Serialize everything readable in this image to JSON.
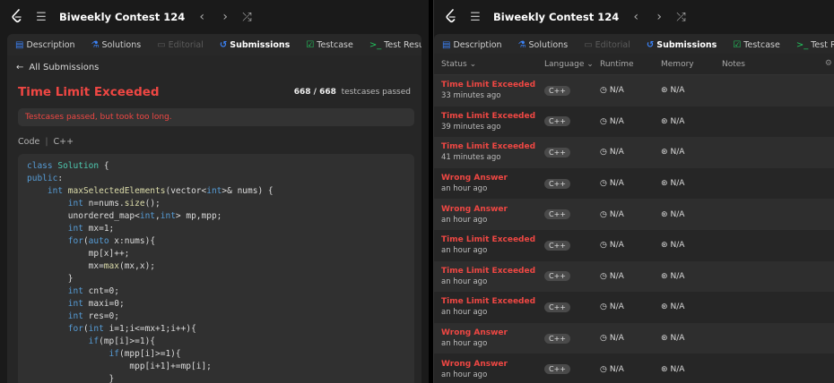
{
  "left": {
    "contest_title": "Biweekly Contest 124",
    "tabs": [
      {
        "label": "Description",
        "icon": "description-icon"
      },
      {
        "label": "Solutions",
        "icon": "flask-icon"
      },
      {
        "label": "Editorial",
        "icon": "book-icon",
        "disabled": true
      },
      {
        "label": "Submissions",
        "icon": "history-icon",
        "active": true
      },
      {
        "label": "Testcase",
        "icon": "checkbox-icon"
      },
      {
        "label": "Test Result",
        "icon": "terminal-icon"
      }
    ],
    "back_label": "All Submissions",
    "verdict": "Time Limit Exceeded",
    "passed_count": "668 / 668",
    "passed_suffix": "testcases passed",
    "message": "Testcases passed, but took too long.",
    "code_label": "Code",
    "code_lang": "C++"
  },
  "right": {
    "contest_title": "Biweekly Contest 124",
    "tabs": [
      {
        "label": "Description"
      },
      {
        "label": "Solutions"
      },
      {
        "label": "Editorial"
      },
      {
        "label": "Submissions"
      },
      {
        "label": "Testcase"
      },
      {
        "label": "Test Result"
      }
    ],
    "columns": {
      "status": "Status",
      "language": "Language",
      "runtime": "Runtime",
      "memory": "Memory",
      "notes": "Notes"
    },
    "rows": [
      {
        "status": "Time Limit Exceeded",
        "time": "33 minutes ago",
        "lang": "C++",
        "runtime": "N/A",
        "memory": "N/A"
      },
      {
        "status": "Time Limit Exceeded",
        "time": "39 minutes ago",
        "lang": "C++",
        "runtime": "N/A",
        "memory": "N/A"
      },
      {
        "status": "Time Limit Exceeded",
        "time": "41 minutes ago",
        "lang": "C++",
        "runtime": "N/A",
        "memory": "N/A"
      },
      {
        "status": "Wrong Answer",
        "time": "an hour ago",
        "lang": "C++",
        "runtime": "N/A",
        "memory": "N/A"
      },
      {
        "status": "Wrong Answer",
        "time": "an hour ago",
        "lang": "C++",
        "runtime": "N/A",
        "memory": "N/A"
      },
      {
        "status": "Time Limit Exceeded",
        "time": "an hour ago",
        "lang": "C++",
        "runtime": "N/A",
        "memory": "N/A"
      },
      {
        "status": "Time Limit Exceeded",
        "time": "an hour ago",
        "lang": "C++",
        "runtime": "N/A",
        "memory": "N/A"
      },
      {
        "status": "Time Limit Exceeded",
        "time": "an hour ago",
        "lang": "C++",
        "runtime": "N/A",
        "memory": "N/A"
      },
      {
        "status": "Wrong Answer",
        "time": "an hour ago",
        "lang": "C++",
        "runtime": "N/A",
        "memory": "N/A"
      },
      {
        "status": "Wrong Answer",
        "time": "an hour ago",
        "lang": "C++",
        "runtime": "N/A",
        "memory": "N/A"
      }
    ]
  },
  "colors": {
    "error": "#ef4743",
    "accent_blue": "#3b82f6",
    "accent_green": "#22c55e",
    "logo_orange": "#ffa116"
  }
}
